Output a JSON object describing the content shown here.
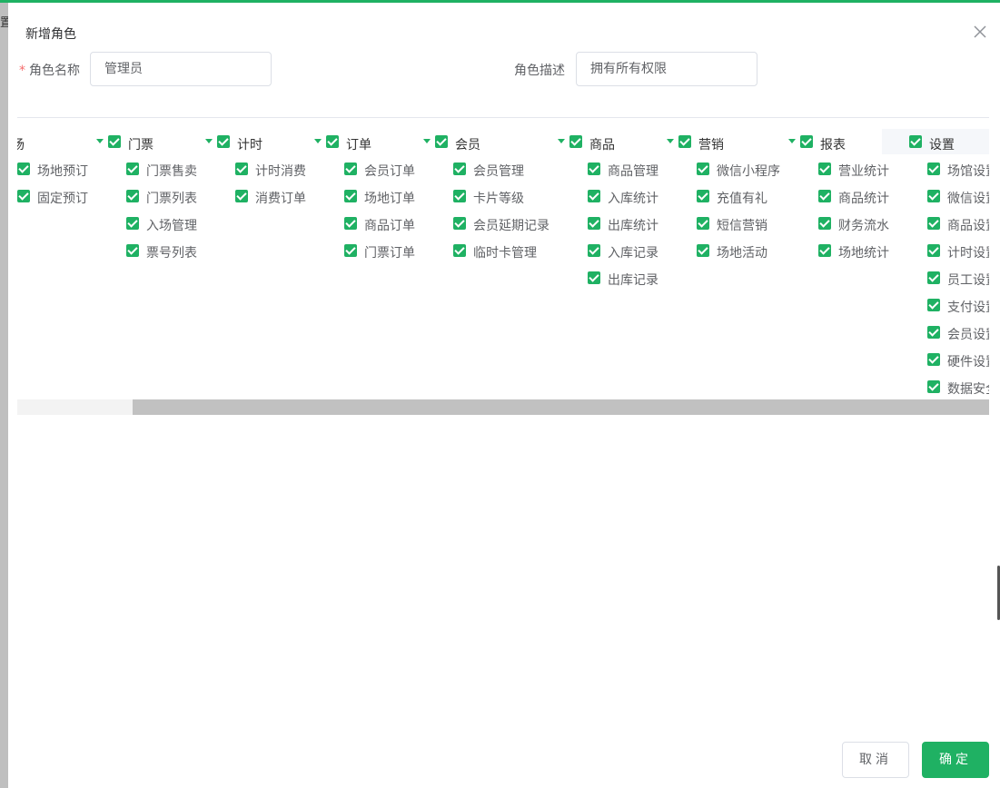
{
  "background_peek": "置",
  "dialog": {
    "title": "新增角色",
    "required_mark": "*",
    "role_name_label": "角色名称",
    "role_name_value": "管理员",
    "role_desc_label": "角色描述",
    "role_desc_value": "拥有所有权限"
  },
  "columns": [
    {
      "title": "订场",
      "items": [
        "场地预订",
        "固定预订"
      ]
    },
    {
      "title": "门票",
      "items": [
        "门票售卖",
        "门票列表",
        "入场管理",
        "票号列表"
      ]
    },
    {
      "title": "计时",
      "items": [
        "计时消费",
        "消费订单"
      ]
    },
    {
      "title": "订单",
      "items": [
        "会员订单",
        "场地订单",
        "商品订单",
        "门票订单"
      ]
    },
    {
      "title": "会员",
      "items": [
        "会员管理",
        "卡片等级",
        "会员延期记录",
        "临时卡管理"
      ]
    },
    {
      "title": "商品",
      "items": [
        "商品管理",
        "入库统计",
        "出库统计",
        "入库记录",
        "出库记录"
      ]
    },
    {
      "title": "营销",
      "items": [
        "微信小程序",
        "充值有礼",
        "短信营销",
        "场地活动"
      ]
    },
    {
      "title": "报表",
      "items": [
        "营业统计",
        "商品统计",
        "财务流水",
        "场地统计"
      ]
    },
    {
      "title": "设置",
      "items": [
        "场馆设置",
        "微信设置",
        "商品设置",
        "计时设置",
        "员工设置",
        "支付设置",
        "会员设置",
        "硬件设置",
        "数据安全"
      ]
    }
  ],
  "buttons": {
    "cancel": "取消",
    "confirm": "确定"
  },
  "colors": {
    "accent": "#1fb163",
    "required": "#f56c6c"
  },
  "scrollbar": {
    "position_fraction": 0.12
  }
}
